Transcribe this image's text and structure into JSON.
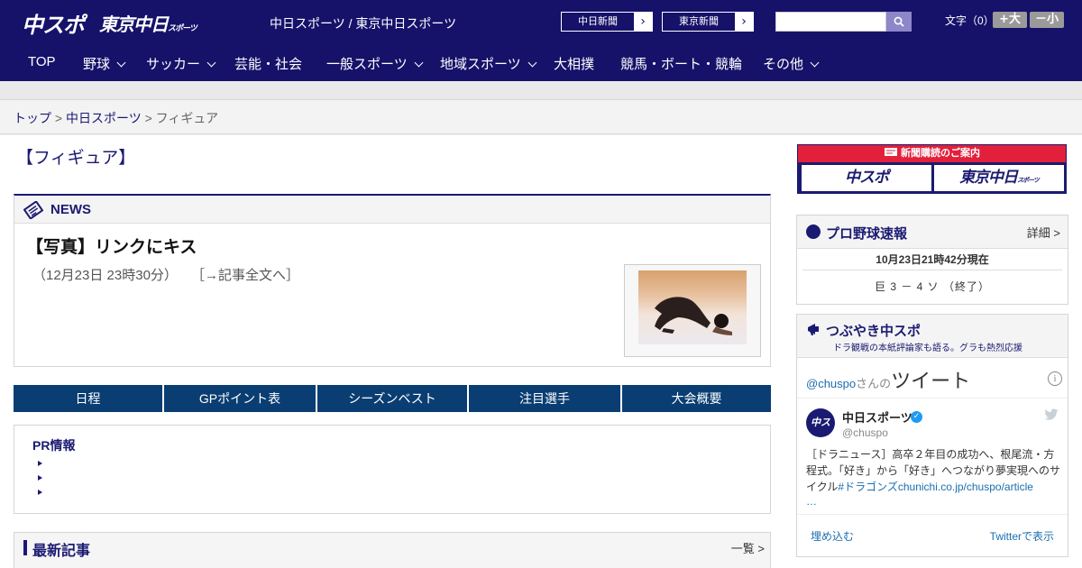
{
  "header": {
    "logo_chuspo": "中スポ",
    "logo_tokyo": "東京中日",
    "logo_tokyo_small": "スポーツ",
    "site_names": "中日スポーツ / 東京中日スポーツ",
    "paper_buttons": [
      "中日新聞",
      "東京新聞"
    ],
    "search": {
      "placeholder": ""
    },
    "font_label": "文字（0）",
    "font_increase": "+大",
    "font_decrease": "－小"
  },
  "nav": {
    "items": [
      "TOP",
      "野球",
      "サッカー",
      "芸能・社会",
      "一般スポーツ",
      "地域スポーツ",
      "大相撲",
      "競馬・ボート・競輪",
      "その他"
    ],
    "has_dropdown": [
      false,
      true,
      true,
      false,
      true,
      true,
      false,
      false,
      true
    ]
  },
  "breadcrumb": {
    "items": [
      "トップ",
      "中日スポーツ",
      "フィギュア"
    ],
    "separator": ">"
  },
  "page": {
    "title": "【フィギュア】"
  },
  "news": {
    "header": "NEWS",
    "headline": "【写真】リンクにキス",
    "datetime": "（12月23日 23時30分）",
    "read_more": "［→記事全文へ］"
  },
  "tabs": [
    "日程",
    "GPポイント表",
    "シーズンベスト",
    "注目選手",
    "大会概要"
  ],
  "pr": {
    "title": "PR情報",
    "items": [
      "",
      "",
      ""
    ]
  },
  "latest": {
    "title": "最新記事",
    "list_link": "一覧 >"
  },
  "sidebar": {
    "subscription": {
      "header": "新聞購読のご案内",
      "logo_chuspo": "中スポ",
      "logo_tokyo": "東京中日",
      "logo_tokyo_small": "スポーツ"
    },
    "baseball": {
      "title": "プロ野球速報",
      "detail_link": "詳細 >",
      "timestamp": "10月23日21時42分現在",
      "score": "巨 3 － 4 ソ （終了）"
    },
    "tweets": {
      "title": "つぶやき中スポ",
      "subtitle": "ドラ観戦の本紙評論家も語る。グラも熱烈応援",
      "handle": "@chuspo",
      "san": "さんの",
      "tweet_label": "ツイート",
      "account_name": "中日スポーツ",
      "account_handle": "@chuspo",
      "avatar_text": "中スポ",
      "tweet_text": "［ドラニュース］高卒２年目の成功へ、根尾流・方程式。「好き」から「好き」へつながり夢実現へのサイクル",
      "tweet_hashtag": "#ドラゴンズ",
      "tweet_link": "chunichi.co.jp/chuspo/article",
      "ellipsis": "…",
      "embed": "埋め込む",
      "view_on_twitter": "Twitterで表示"
    }
  },
  "colors": {
    "brand_navy": "#16126a",
    "tab_blue": "#0a3e73",
    "accent_red": "#e2203b",
    "link_blue": "#1b6eaf"
  }
}
